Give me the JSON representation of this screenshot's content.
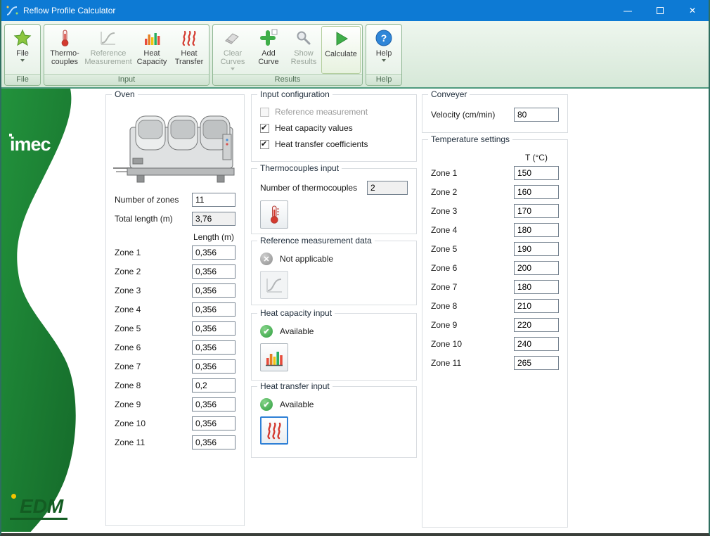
{
  "window": {
    "title": "Reflow Profile Calculator"
  },
  "colors": {
    "titlebar": "#0d7ad4",
    "accent_green": "#3fae49",
    "ribbon_border": "#8fb793",
    "sidebar_green": "#1f8a37"
  },
  "ribbon": {
    "file": {
      "caption": "File",
      "button": "File"
    },
    "input": {
      "caption": "Input",
      "thermocouples": "Thermo-couples",
      "reference": "Reference Measurement",
      "heat_capacity": "Heat Capacity",
      "heat_transfer": "Heat Transfer"
    },
    "results": {
      "caption": "Results",
      "clear": "Clear Curves",
      "add": "Add Curve",
      "show": "Show Results",
      "calculate": "Calculate"
    },
    "help": {
      "caption": "Help",
      "button": "Help"
    }
  },
  "sidebar": {
    "brand_top": "imec",
    "brand_bottom": "EDM"
  },
  "oven": {
    "title": "Oven",
    "zones_label": "Number of zones",
    "zones_value": "11",
    "total_label": "Total length (m)",
    "total_value": "3,76",
    "length_header": "Length (m)",
    "rows": [
      {
        "label": "Zone 1",
        "value": "0,356"
      },
      {
        "label": "Zone 2",
        "value": "0,356"
      },
      {
        "label": "Zone 3",
        "value": "0,356"
      },
      {
        "label": "Zone 4",
        "value": "0,356"
      },
      {
        "label": "Zone 5",
        "value": "0,356"
      },
      {
        "label": "Zone 6",
        "value": "0,356"
      },
      {
        "label": "Zone 7",
        "value": "0,356"
      },
      {
        "label": "Zone 8",
        "value": "0,2"
      },
      {
        "label": "Zone 9",
        "value": "0,356"
      },
      {
        "label": "Zone 10",
        "value": "0,356"
      },
      {
        "label": "Zone 11",
        "value": "0,356"
      }
    ]
  },
  "input_config": {
    "title": "Input configuration",
    "options": [
      {
        "label": "Reference measurement"
      },
      {
        "label": "Heat capacity values"
      },
      {
        "label": "Heat transfer coefficients"
      }
    ]
  },
  "thermocouples": {
    "title": "Thermocouples input",
    "label": "Number of thermocouples",
    "value": "2"
  },
  "reference_data": {
    "title": "Reference measurement data",
    "status": "Not applicable"
  },
  "heat_capacity": {
    "title": "Heat capacity input",
    "status": "Available"
  },
  "heat_transfer": {
    "title": "Heat transfer input",
    "status": "Available"
  },
  "conveyer": {
    "title": "Conveyer",
    "velocity_label": "Velocity (cm/min)",
    "velocity_value": "80"
  },
  "temperature": {
    "title": "Temperature settings",
    "header": "T (°C)",
    "rows": [
      {
        "label": "Zone 1",
        "value": "150"
      },
      {
        "label": "Zone 2",
        "value": "160"
      },
      {
        "label": "Zone 3",
        "value": "170"
      },
      {
        "label": "Zone 4",
        "value": "180"
      },
      {
        "label": "Zone 5",
        "value": "190"
      },
      {
        "label": "Zone 6",
        "value": "200"
      },
      {
        "label": "Zone 7",
        "value": "180"
      },
      {
        "label": "Zone 8",
        "value": "210"
      },
      {
        "label": "Zone 9",
        "value": "220"
      },
      {
        "label": "Zone 10",
        "value": "240"
      },
      {
        "label": "Zone 11",
        "value": "265"
      }
    ]
  }
}
